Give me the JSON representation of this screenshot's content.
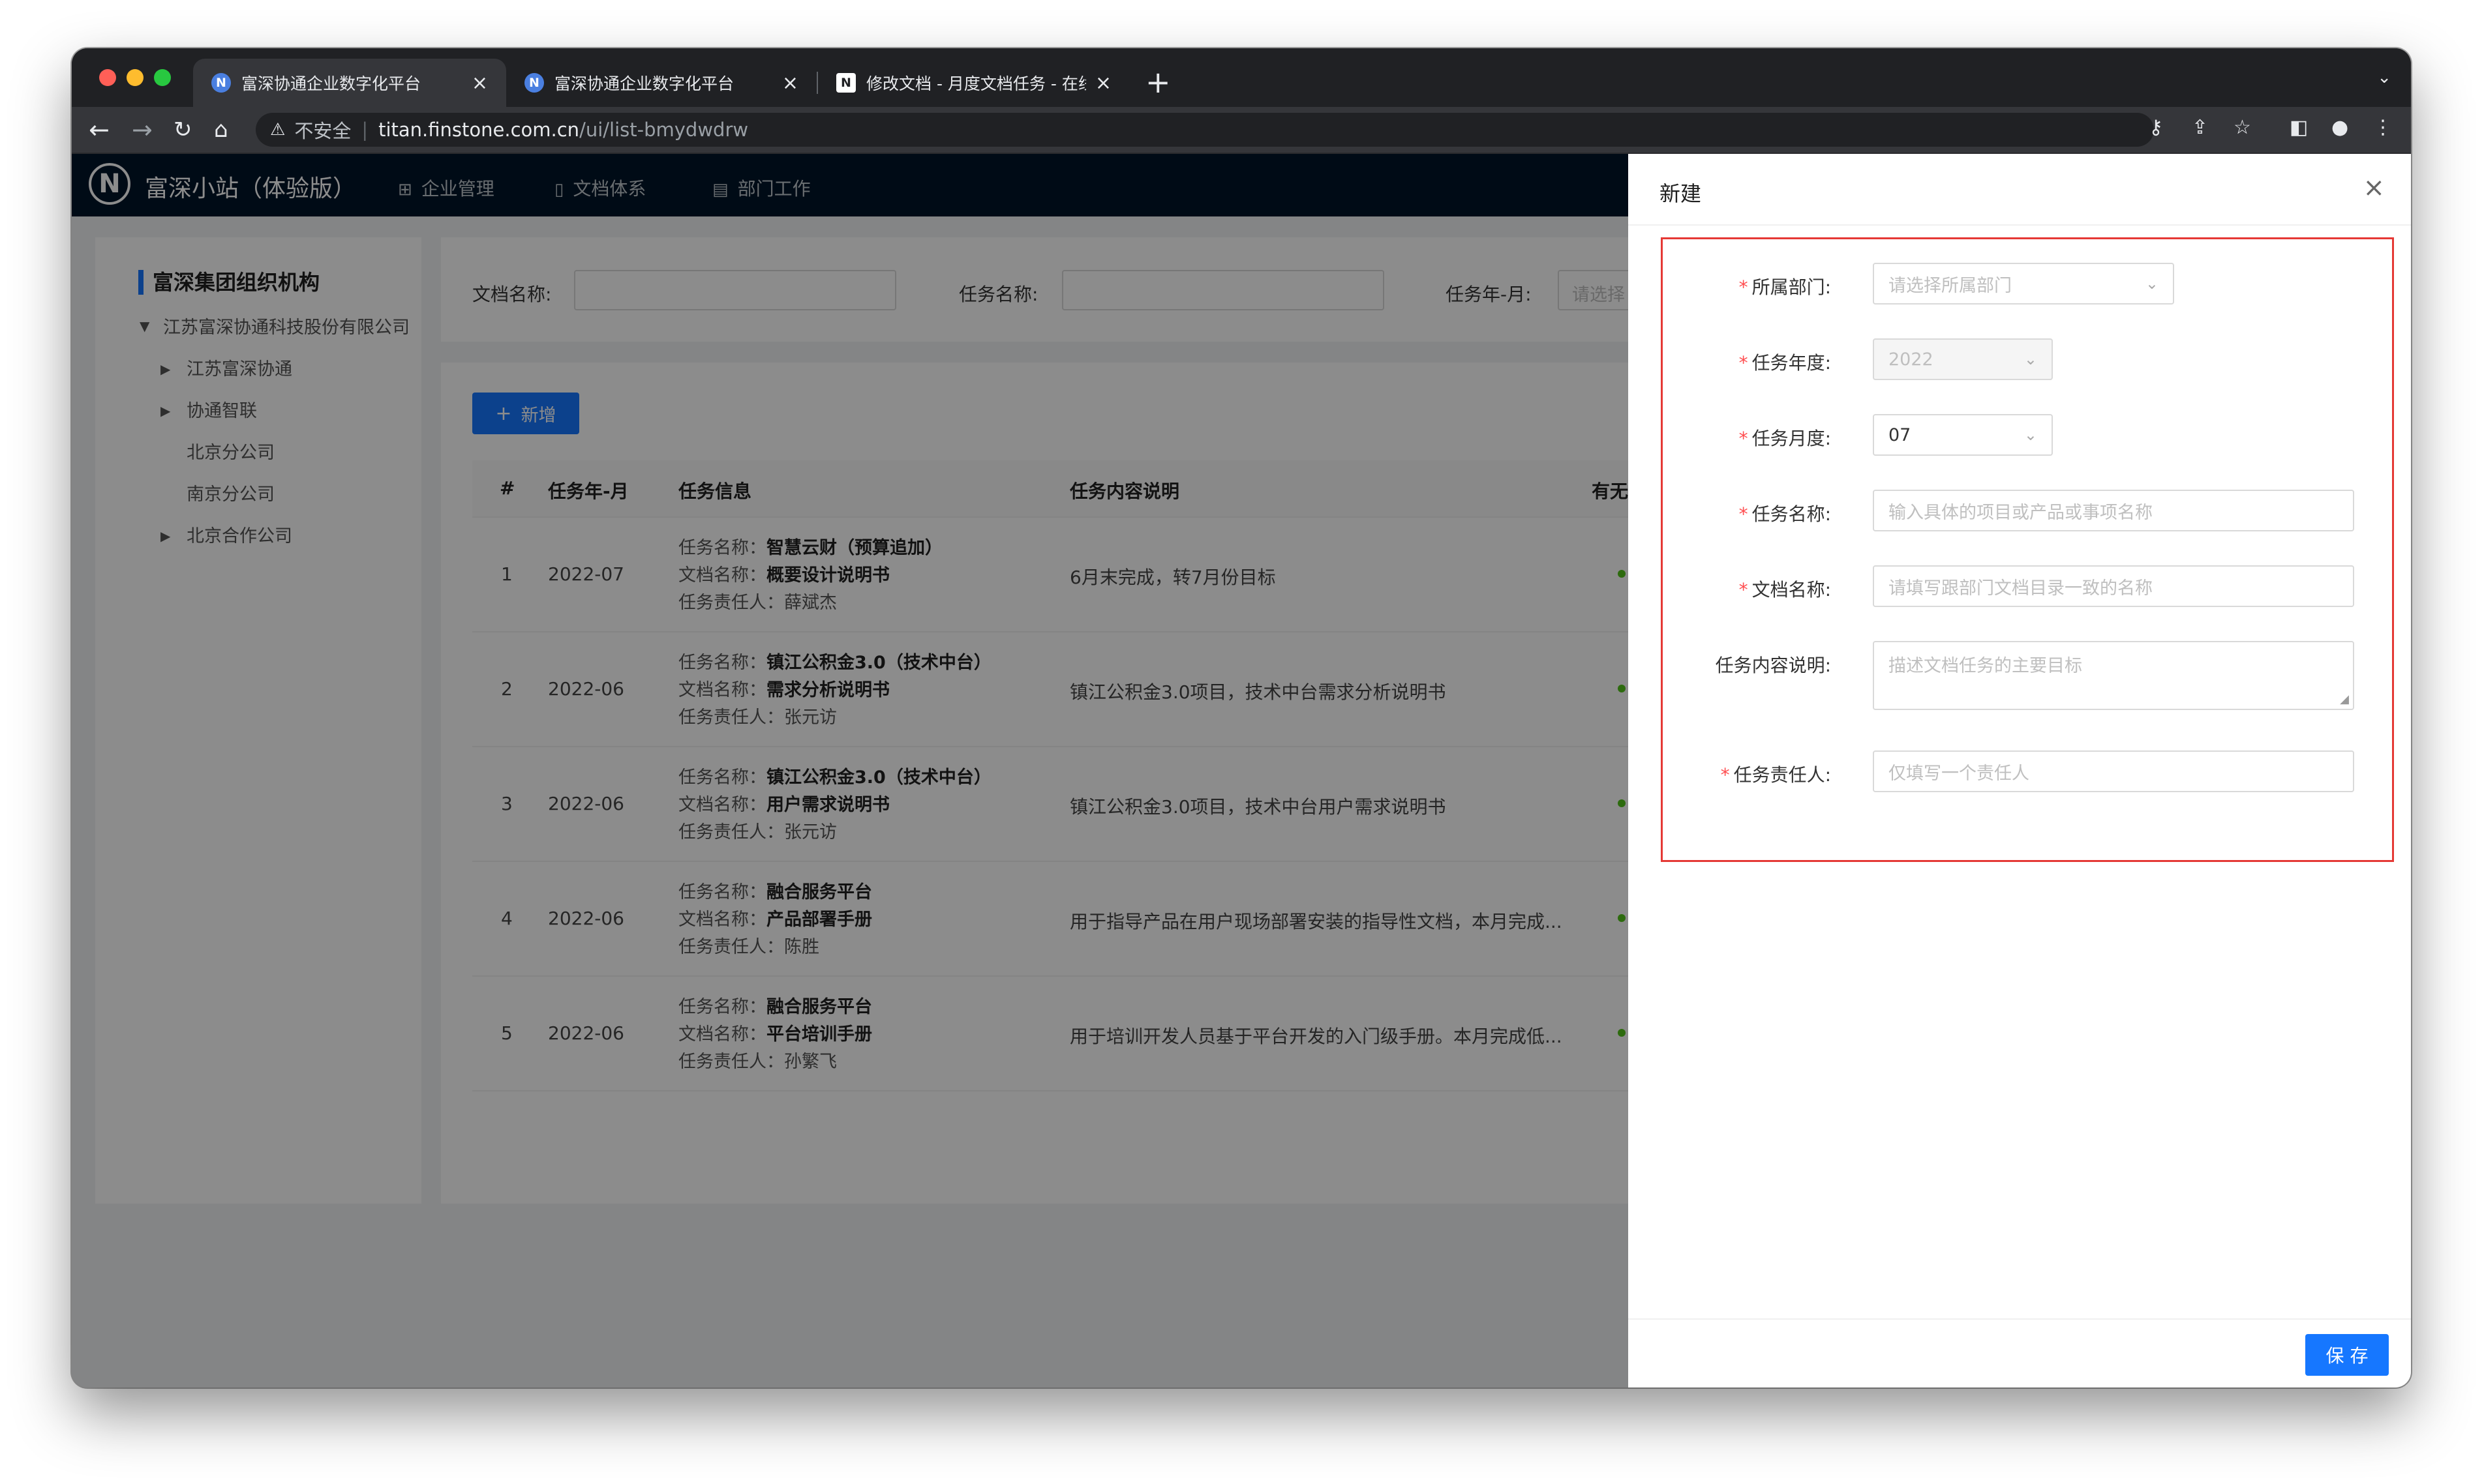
{
  "browser": {
    "tabs": [
      {
        "title": "富深协通企业数字化平台",
        "favicon": "N"
      },
      {
        "title": "富深协通企业数字化平台",
        "favicon": "N"
      },
      {
        "title": "修改文档 - 月度文档任务 - 在线文",
        "favicon": "N"
      }
    ],
    "address": {
      "security_label": "不安全",
      "host": "titan.finstone.com.cn",
      "path": "/ui/list-bmydwdrw"
    }
  },
  "app": {
    "logo_letter": "N",
    "title": "富深小站（体验版）",
    "menu": [
      "企业管理",
      "文档体系",
      "部门工作"
    ]
  },
  "sidebar": {
    "title": "富深集团组织机构",
    "tree": [
      {
        "label": "江苏富深协通科技股份有限公司",
        "expanded": true
      },
      {
        "label": "江苏富深协通",
        "has_children": true
      },
      {
        "label": "协通智联",
        "has_children": true
      },
      {
        "label": "北京分公司",
        "has_children": false
      },
      {
        "label": "南京分公司",
        "has_children": false
      },
      {
        "label": "北京合作公司",
        "has_children": true
      }
    ]
  },
  "filters": {
    "doc_name_label": "文档名称:",
    "task_name_label": "任务名称:",
    "task_month_label": "任务年-月:",
    "task_month_placeholder": "请选择"
  },
  "table": {
    "add_label": "新增",
    "headers": [
      "#",
      "任务年-月",
      "任务信息",
      "任务内容说明",
      "有无"
    ],
    "info_labels": {
      "task": "任务名称：",
      "doc": "文档名称：",
      "owner": "任务责任人："
    },
    "rows": [
      {
        "num": "1",
        "month": "2022-07",
        "task": "智慧云财（预算追加）",
        "doc": "概要设计说明书",
        "owner": "薛斌杰",
        "desc": "6月末完成，转7月份目标"
      },
      {
        "num": "2",
        "month": "2022-06",
        "task": "镇江公积金3.0（技术中台）",
        "doc": "需求分析说明书",
        "owner": "张元访",
        "desc": "镇江公积金3.0项目，技术中台需求分析说明书"
      },
      {
        "num": "3",
        "month": "2022-06",
        "task": "镇江公积金3.0（技术中台）",
        "doc": "用户需求说明书",
        "owner": "张元访",
        "desc": "镇江公积金3.0项目，技术中台用户需求说明书"
      },
      {
        "num": "4",
        "month": "2022-06",
        "task": "融合服务平台",
        "doc": "产品部署手册",
        "owner": "陈胜",
        "desc": "用于指导产品在用户现场部署安装的指导性文档，本月完成..."
      },
      {
        "num": "5",
        "month": "2022-06",
        "task": "融合服务平台",
        "doc": "平台培训手册",
        "owner": "孙繁飞",
        "desc": "用于培训开发人员基于平台开发的入门级手册。本月完成低..."
      }
    ]
  },
  "drawer": {
    "title": "新建",
    "fields": {
      "dept_label": "所属部门:",
      "dept_placeholder": "请选择所属部门",
      "year_label": "任务年度:",
      "year_value": "2022",
      "month_label": "任务月度:",
      "month_value": "07",
      "task_label": "任务名称:",
      "task_placeholder": "输入具体的项目或产品或事项名称",
      "doc_label": "文档名称:",
      "doc_placeholder": "请填写跟部门文档目录一致的名称",
      "desc_label": "任务内容说明:",
      "desc_placeholder": "描述文档任务的主要目标",
      "owner_label": "任务责任人:",
      "owner_placeholder": "仅填写一个责任人"
    },
    "save_label": "保 存"
  },
  "colors": {
    "primary": "#1677ff",
    "header_bg": "#001529",
    "required": "#ff4d4f",
    "highlight_border": "#e53935"
  }
}
